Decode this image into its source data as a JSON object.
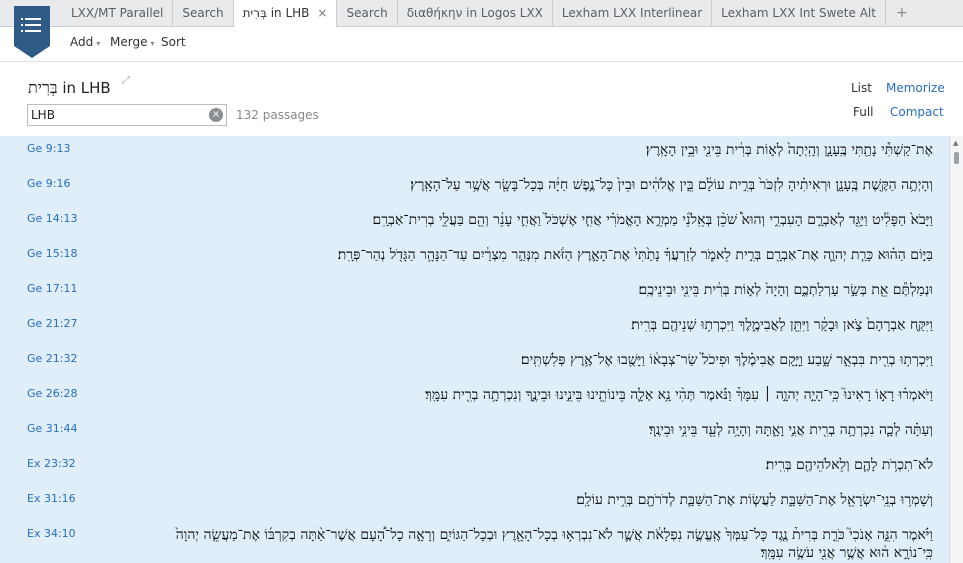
{
  "tabs": [
    {
      "label": "LXX/MT Parallel",
      "active": false
    },
    {
      "label": "Search",
      "active": false
    },
    {
      "label": "בְּרִית in LHB",
      "active": true,
      "close": "×"
    },
    {
      "label": "Search",
      "active": false
    },
    {
      "label": "διαθήκην in Logos LXX",
      "active": false
    },
    {
      "label": "Lexham LXX Interlinear",
      "active": false
    },
    {
      "label": "Lexham LXX Int Swete Alt",
      "active": false
    }
  ],
  "tab_add": "+",
  "toolbar": {
    "add": "Add",
    "merge": "Merge",
    "sort": "Sort",
    "caret": "▾"
  },
  "header": {
    "title_hebrew": "בְּרִית",
    "title_suffix": "in LHB",
    "pin_glyph": "⤢",
    "search_value": "LHB",
    "clear_glyph": "×",
    "count": "132 passages",
    "list_label": "List",
    "memorize_label": "Memorize",
    "full_label": "Full",
    "compact_label": "Compact"
  },
  "icons": {
    "menu": "menu-icon",
    "clear": "clear-icon",
    "pin": "pin-icon",
    "scroll_up": "scroll-up-icon"
  },
  "colors": {
    "accent": "#2f5b86",
    "link": "#2a6ebb",
    "results_bg": "#dfeef8"
  },
  "scroll_up_glyph": "▲",
  "results": [
    {
      "ref": "Ge 9:13",
      "text": "אֶת־קַשְׁתִּ֕י נָתַ֖תִּי בֶּֽעָנָ֑ן וְהָֽיְתָה֙ לְא֣וֹת בְּרִ֔ית בֵּינִ֖י וּבֵ֥ין הָאָֽרֶץ׃"
    },
    {
      "ref": "Ge 9:16",
      "text": "וְהָיְתָ֥ה הַקֶּ֖שֶׁת בֶּֽעָנָ֑ן וּרְאִיתִ֗יהָ לִזְכֹּר֙ בְּרִ֣ית עוֹלָ֔ם בֵּ֣ין אֱלֹהִ֔ים וּבֵין֙ כָּל־נֶ֣פֶשׁ חַיָּ֔ה בְּכָל־בָּשָׂ֖ר אֲשֶׁ֥ר עַל־הָאָֽרֶץ׃"
    },
    {
      "ref": "Ge 14:13",
      "text": "וַיָּבֹא֙ הַפָּלִ֔יט וַיַּגֵּ֖ד לְאַבְרָ֣ם הָעִבְרִ֑י וְהוּא֩ שֹׁכֵ֨ן בְּאֵֽלֹנֵ֜י מַמְרֵ֣א הָאֱמֹרִ֗י אֲחִ֤י אֶשְׁכֹּל֙ וַאֲחִ֣י עָנֵ֔ר וְהֵ֖ם בַּעֲלֵ֥י בְרִית־אַבְרָֽם׃"
    },
    {
      "ref": "Ge 15:18",
      "text": "בַּיּ֣וֹם הַה֗וּא כָּרַ֧ת יְהוָ֛ה אֶת־אַבְרָ֖ם בְּרִ֣ית לֵאמֹ֑ר לְזַרְעֲךָ֗ נָתַ֙תִּי֙ אֶת־הָאָ֣רֶץ הַזֹּ֔את מִנְּהַ֣ר מִצְרַ֔יִם עַד־הַנָּהָ֥ר הַגָּדֹ֖ל נְהַר־פְּרָֽת׃"
    },
    {
      "ref": "Ge 17:11",
      "text": "וּנְמַלְתֶּ֕ם אֵ֖ת בְּשַׂ֣ר עָרְלַתְכֶ֑ם וְהָיָה֙ לְא֣וֹת בְּרִ֔ית בֵּינִ֖י וּבֵינֵיכֶֽם׃"
    },
    {
      "ref": "Ge 21:27",
      "text": "וַיִּקַּ֤ח אַבְרָהָם֙ צֹ֣אן וּבָקָ֔ר וַיִּתֵּ֖ן לַאֲבִימֶ֑לֶךְ וַיִּכְרְת֥וּ שְׁנֵיהֶ֖ם בְּרִֽית׃"
    },
    {
      "ref": "Ge 21:32",
      "text": "וַיִּכְרְת֥וּ בְרִ֖ית בִּבְאֵ֣ר שָׁ֑בַע וַיָּ֣קָם אֲבִימֶ֗לֶךְ וּפִיכֹל֙ שַׂר־צְבָא֔וֹ וַיָּשֻׁ֖בוּ אֶל־אֶ֥רֶץ פְּלִשְׁתִּֽים׃"
    },
    {
      "ref": "Ge 26:28",
      "text": "וַיֹּאמְר֗וּ רָא֣וֹ רָאִינוּ֮ כִּֽי־הָיָ֣ה יְהוָ֣ה ׀ עִמָּךְ֒ וַנֹּ֗אמֶר תְּהִ֨י נָ֥א אָלָ֛ה בֵּינוֹתֵ֖ינוּ בֵּינֵ֣ינוּ וּבֵינֶ֑ךָ וְנִכְרְתָ֥ה בְרִ֖ית עִמָּֽךְ׃"
    },
    {
      "ref": "Ge 31:44",
      "text": "וְעַתָּ֗ה לְכָ֛ה נִכְרְתָ֥ה בְרִ֖ית אֲנִ֣י וָאָ֑תָּה וְהָיָ֥ה לְעֵ֖ד בֵּינִ֥י וּבֵינֶֽךָ׃"
    },
    {
      "ref": "Ex 23:32",
      "text": "לֹא־תִכְרֹ֥ת לָהֶ֛ם וְלֵאלֹהֵיהֶ֖ם בְּרִֽית׃"
    },
    {
      "ref": "Ex 31:16",
      "text": "וְשָׁמְר֥וּ בְנֵֽי־יִשְׂרָאֵ֖ל אֶת־הַשַּׁבָּ֑ת לַעֲשׂ֧וֹת אֶת־הַשַּׁבָּ֛ת לְדֹרֹתָ֖ם בְּרִ֥ית עוֹלָֽם׃"
    },
    {
      "ref": "Ex 34:10",
      "text": "וַיֹּ֗אמֶר הִנֵּ֣ה אָנֹכִי֮ כֹּרֵ֣ת בְּרִית֒ נֶ֤גֶד כָּל־עַמְּךָ֙ אֶֽעֱשֶׂ֣ה נִפְלָאֹ֔ת אֲשֶׁ֛ר לֹא־נִבְרְא֥וּ בְכָל־הָאָ֖רֶץ וּבְכָל־הַגּוֹיִ֑ם וְרָאָ֣ה כָל־הָ֠עָם אֲשֶׁר־אַ֨תָּה בְקִרְבּ֜וֹ אֶת־מַעֲשֵׂ֤ה יְהוָה֙ כִּֽי־נוֹרָ֣א ה֔וּא אֲשֶׁ֥ר אֲנִ֖י עֹשֶׂ֥ה עִמָּֽךְ׃"
    }
  ]
}
